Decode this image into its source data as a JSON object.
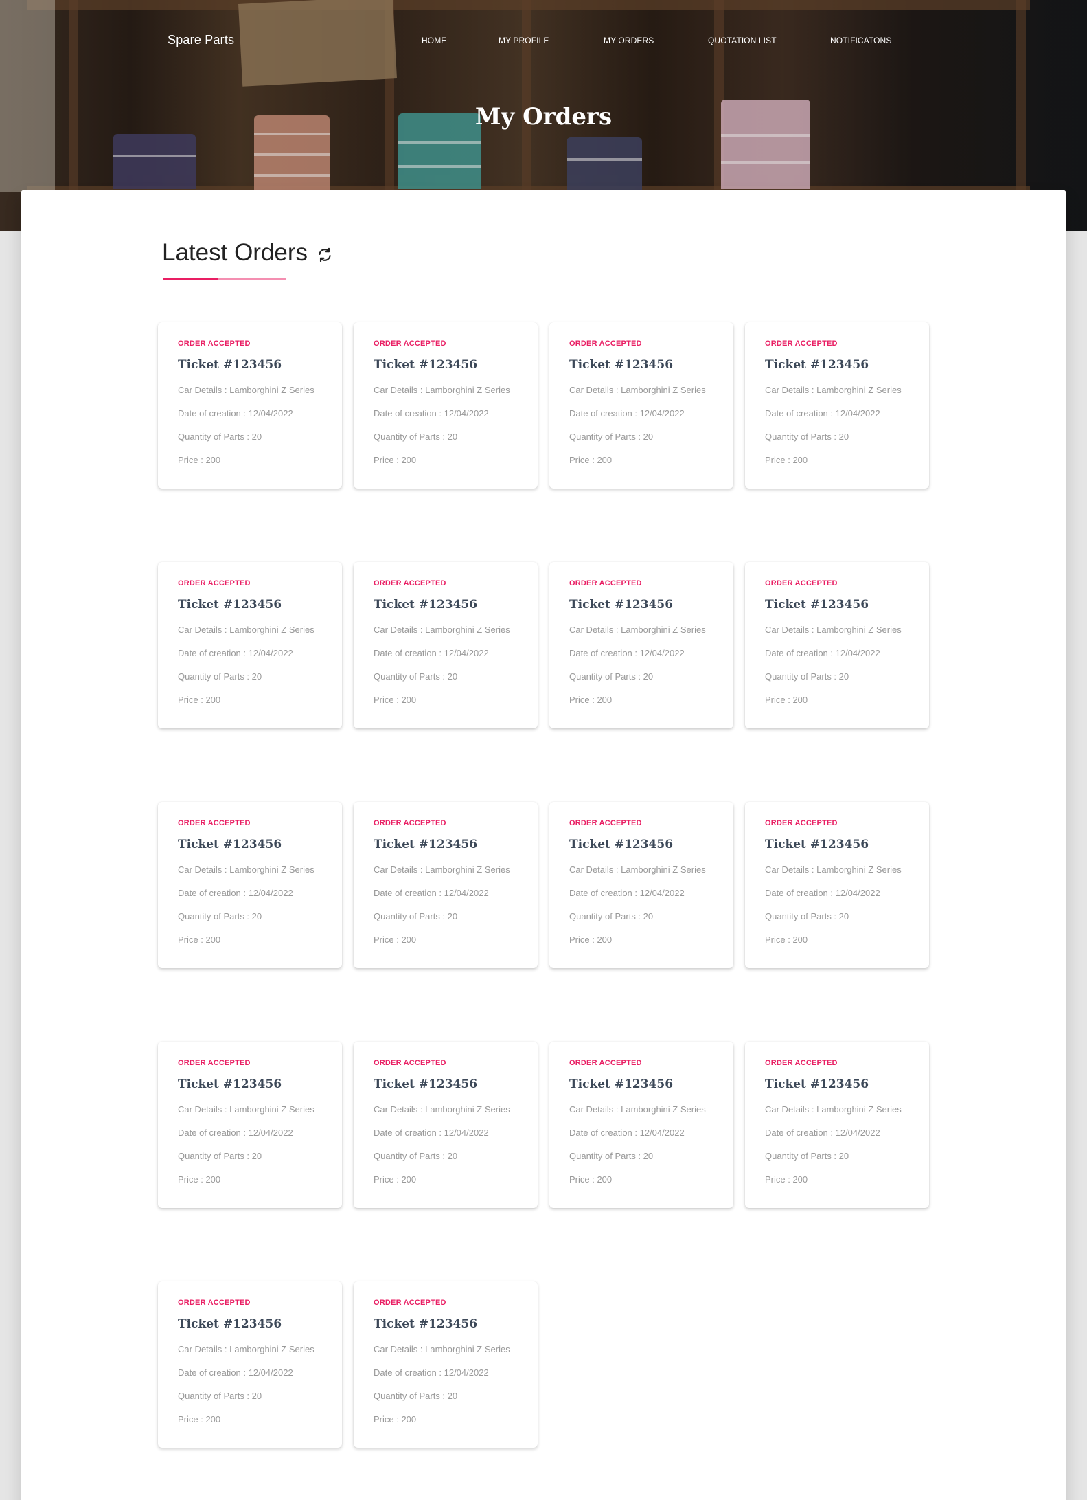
{
  "nav": {
    "brand": "Spare Parts",
    "items": [
      {
        "label": "HOME"
      },
      {
        "label": "MY PROFILE"
      },
      {
        "label": "MY ORDERS"
      },
      {
        "label": "QUOTATION LIST"
      },
      {
        "label": "NOTIFICATONS"
      }
    ]
  },
  "hero": {
    "title": "My Orders"
  },
  "section": {
    "title": "Latest Orders",
    "refresh_icon": "refresh-icon",
    "accent_color": "#e91e63",
    "accent_light_color": "#f48fb1"
  },
  "orders": [
    {
      "status": "ORDER ACCEPTED",
      "ticket": "Ticket #123456",
      "car": "Car Details : Lamborghini Z Series",
      "date": "Date of creation : 12/04/2022",
      "qty": "Quantity of Parts : 20",
      "price": "Price : 200"
    },
    {
      "status": "ORDER ACCEPTED",
      "ticket": "Ticket #123456",
      "car": "Car Details : Lamborghini Z Series",
      "date": "Date of creation : 12/04/2022",
      "qty": "Quantity of Parts : 20",
      "price": "Price : 200"
    },
    {
      "status": "ORDER ACCEPTED",
      "ticket": "Ticket #123456",
      "car": "Car Details : Lamborghini Z Series",
      "date": "Date of creation : 12/04/2022",
      "qty": "Quantity of Parts : 20",
      "price": "Price : 200"
    },
    {
      "status": "ORDER ACCEPTED",
      "ticket": "Ticket #123456",
      "car": "Car Details : Lamborghini Z Series",
      "date": "Date of creation : 12/04/2022",
      "qty": "Quantity of Parts : 20",
      "price": "Price : 200"
    },
    {
      "status": "ORDER ACCEPTED",
      "ticket": "Ticket #123456",
      "car": "Car Details : Lamborghini Z Series",
      "date": "Date of creation : 12/04/2022",
      "qty": "Quantity of Parts : 20",
      "price": "Price : 200"
    },
    {
      "status": "ORDER ACCEPTED",
      "ticket": "Ticket #123456",
      "car": "Car Details : Lamborghini Z Series",
      "date": "Date of creation : 12/04/2022",
      "qty": "Quantity of Parts : 20",
      "price": "Price : 200"
    },
    {
      "status": "ORDER ACCEPTED",
      "ticket": "Ticket #123456",
      "car": "Car Details : Lamborghini Z Series",
      "date": "Date of creation : 12/04/2022",
      "qty": "Quantity of Parts : 20",
      "price": "Price : 200"
    },
    {
      "status": "ORDER ACCEPTED",
      "ticket": "Ticket #123456",
      "car": "Car Details : Lamborghini Z Series",
      "date": "Date of creation : 12/04/2022",
      "qty": "Quantity of Parts : 20",
      "price": "Price : 200"
    },
    {
      "status": "ORDER ACCEPTED",
      "ticket": "Ticket #123456",
      "car": "Car Details : Lamborghini Z Series",
      "date": "Date of creation : 12/04/2022",
      "qty": "Quantity of Parts : 20",
      "price": "Price : 200"
    },
    {
      "status": "ORDER ACCEPTED",
      "ticket": "Ticket #123456",
      "car": "Car Details : Lamborghini Z Series",
      "date": "Date of creation : 12/04/2022",
      "qty": "Quantity of Parts : 20",
      "price": "Price : 200"
    },
    {
      "status": "ORDER ACCEPTED",
      "ticket": "Ticket #123456",
      "car": "Car Details : Lamborghini Z Series",
      "date": "Date of creation : 12/04/2022",
      "qty": "Quantity of Parts : 20",
      "price": "Price : 200"
    },
    {
      "status": "ORDER ACCEPTED",
      "ticket": "Ticket #123456",
      "car": "Car Details : Lamborghini Z Series",
      "date": "Date of creation : 12/04/2022",
      "qty": "Quantity of Parts : 20",
      "price": "Price : 200"
    },
    {
      "status": "ORDER ACCEPTED",
      "ticket": "Ticket #123456",
      "car": "Car Details : Lamborghini Z Series",
      "date": "Date of creation : 12/04/2022",
      "qty": "Quantity of Parts : 20",
      "price": "Price : 200"
    },
    {
      "status": "ORDER ACCEPTED",
      "ticket": "Ticket #123456",
      "car": "Car Details : Lamborghini Z Series",
      "date": "Date of creation : 12/04/2022",
      "qty": "Quantity of Parts : 20",
      "price": "Price : 200"
    },
    {
      "status": "ORDER ACCEPTED",
      "ticket": "Ticket #123456",
      "car": "Car Details : Lamborghini Z Series",
      "date": "Date of creation : 12/04/2022",
      "qty": "Quantity of Parts : 20",
      "price": "Price : 200"
    },
    {
      "status": "ORDER ACCEPTED",
      "ticket": "Ticket #123456",
      "car": "Car Details : Lamborghini Z Series",
      "date": "Date of creation : 12/04/2022",
      "qty": "Quantity of Parts : 20",
      "price": "Price : 200"
    },
    {
      "status": "ORDER ACCEPTED",
      "ticket": "Ticket #123456",
      "car": "Car Details : Lamborghini Z Series",
      "date": "Date of creation : 12/04/2022",
      "qty": "Quantity of Parts : 20",
      "price": "Price : 200"
    },
    {
      "status": "ORDER ACCEPTED",
      "ticket": "Ticket #123456",
      "car": "Car Details : Lamborghini Z Series",
      "date": "Date of creation : 12/04/2022",
      "qty": "Quantity of Parts : 20",
      "price": "Price : 200"
    }
  ]
}
